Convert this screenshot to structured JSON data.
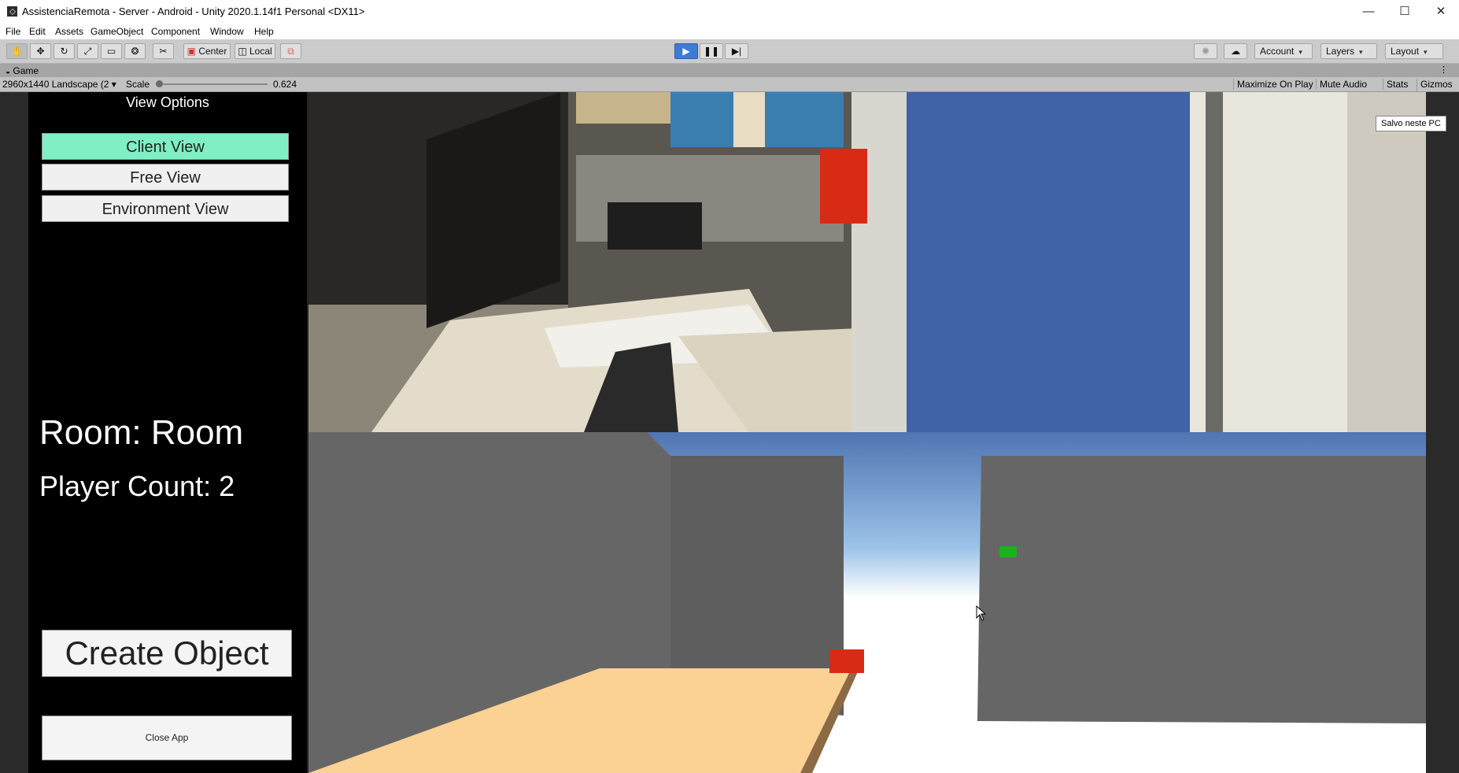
{
  "window": {
    "title": "AssistenciaRemota - Server - Android - Unity 2020.1.14f1 Personal <DX11>",
    "minimize": "—",
    "maximize": "☐",
    "close": "✕"
  },
  "menu": [
    "File",
    "Edit",
    "Assets",
    "GameObject",
    "Component",
    "Window",
    "Help"
  ],
  "toolbar": {
    "pivot_center": "Center",
    "pivot_local": "Local",
    "account": "Account",
    "layers": "Layers",
    "layout": "Layout"
  },
  "tab": {
    "label": "Game"
  },
  "gamebar": {
    "resolution": "2960x1440 Landscape (2",
    "scale_label": "Scale",
    "scale_value": "0.624",
    "maximize_on_play": "Maximize On Play",
    "mute_audio": "Mute Audio",
    "stats": "Stats",
    "gizmos": "Gizmos"
  },
  "panel": {
    "view_options": "View Options",
    "client_view": "Client View",
    "free_view": "Free View",
    "environment_view": "Environment View",
    "room": "Room: Room",
    "player_count": "Player Count: 2",
    "create_object": "Create Object",
    "close_app": "Close App"
  },
  "tooltip": "Salvo neste PC",
  "colors": {
    "accent_active": "#7ff0c4",
    "play_button": "#3d7bd6",
    "cube_red": "#d92a16",
    "cube_green": "#19b31e"
  }
}
